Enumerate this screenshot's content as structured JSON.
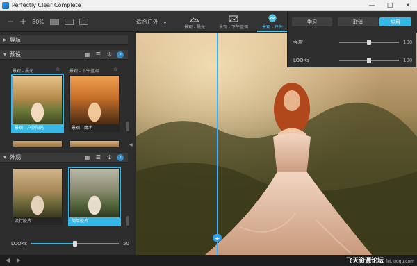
{
  "window": {
    "title": "Perfectly Clear Complete",
    "minimize": "—",
    "maximize": "□",
    "close": "✕"
  },
  "toolbar": {
    "zoom_minus": "−",
    "zoom_plus": "+",
    "zoom_value": "80%",
    "preset_select": "适合户外",
    "tabs": [
      {
        "label": "景观 - 晨光"
      },
      {
        "label": "景观 - 下午蓝调"
      },
      {
        "label": "景观 - 户外"
      }
    ]
  },
  "sidebar": {
    "nav_section": "导航",
    "presets_section": "预设",
    "presets_row_labels": [
      "景观 - 晨光",
      "景观 - 下午蓝调"
    ],
    "presets": [
      {
        "caption": "景观 - 户外阳光",
        "selected": true
      },
      {
        "caption": "景观 - 魔术",
        "selected": false
      }
    ],
    "looks_section": "外观",
    "looks": [
      {
        "caption": "流行胶片",
        "selected": false
      },
      {
        "caption": "简单胶片",
        "selected": true
      }
    ],
    "looks_slider": {
      "label": "LOOKs",
      "value": "50"
    }
  },
  "panel": {
    "learn_label": "学习",
    "cancel_label": "取消",
    "apply_label": "应用",
    "strength_label": "强度",
    "strength_value": "100",
    "looks_label": "LOOKs",
    "looks_value": "100"
  },
  "watermark": {
    "text": "飞天资源论坛",
    "sub": "fei.luoqu.com"
  },
  "colors": {
    "accent": "#35b7e8",
    "split": "#3ab0ff"
  }
}
